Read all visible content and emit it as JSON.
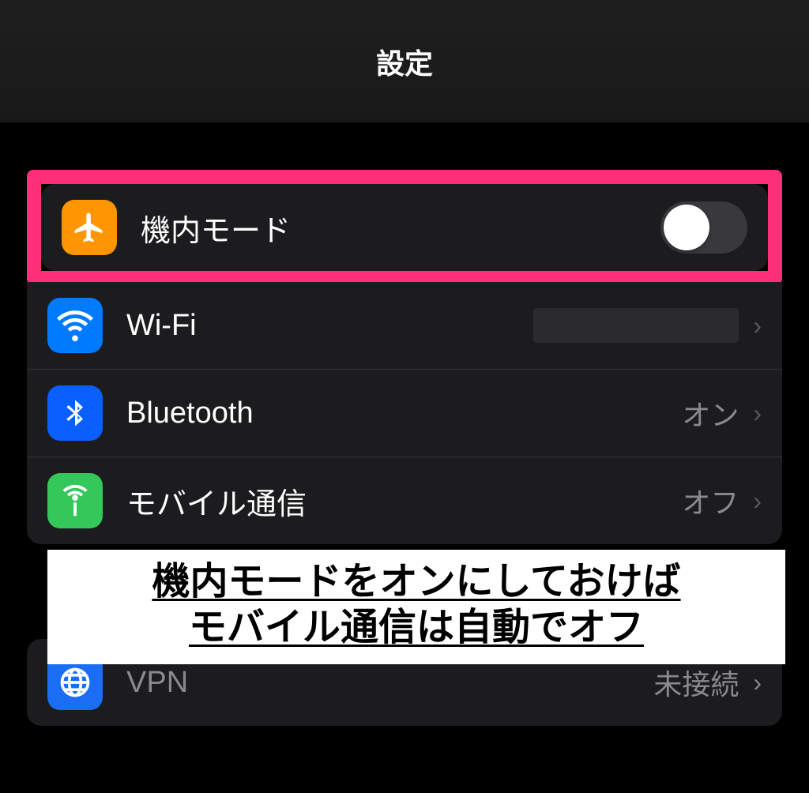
{
  "header": {
    "title": "設定"
  },
  "rows": {
    "airplane": {
      "label": "機内モード"
    },
    "wifi": {
      "label": "Wi-Fi"
    },
    "bluetooth": {
      "label": "Bluetooth",
      "value": "オン"
    },
    "cellular": {
      "label": "モバイル通信",
      "value": "オフ"
    },
    "vpn": {
      "label": "VPN",
      "value": "未接続"
    }
  },
  "annotation": {
    "line1": "機内モードをオンにしておけば",
    "line2": "モバイル通信は自動でオフ"
  },
  "colors": {
    "highlight": "#ff2e78"
  }
}
